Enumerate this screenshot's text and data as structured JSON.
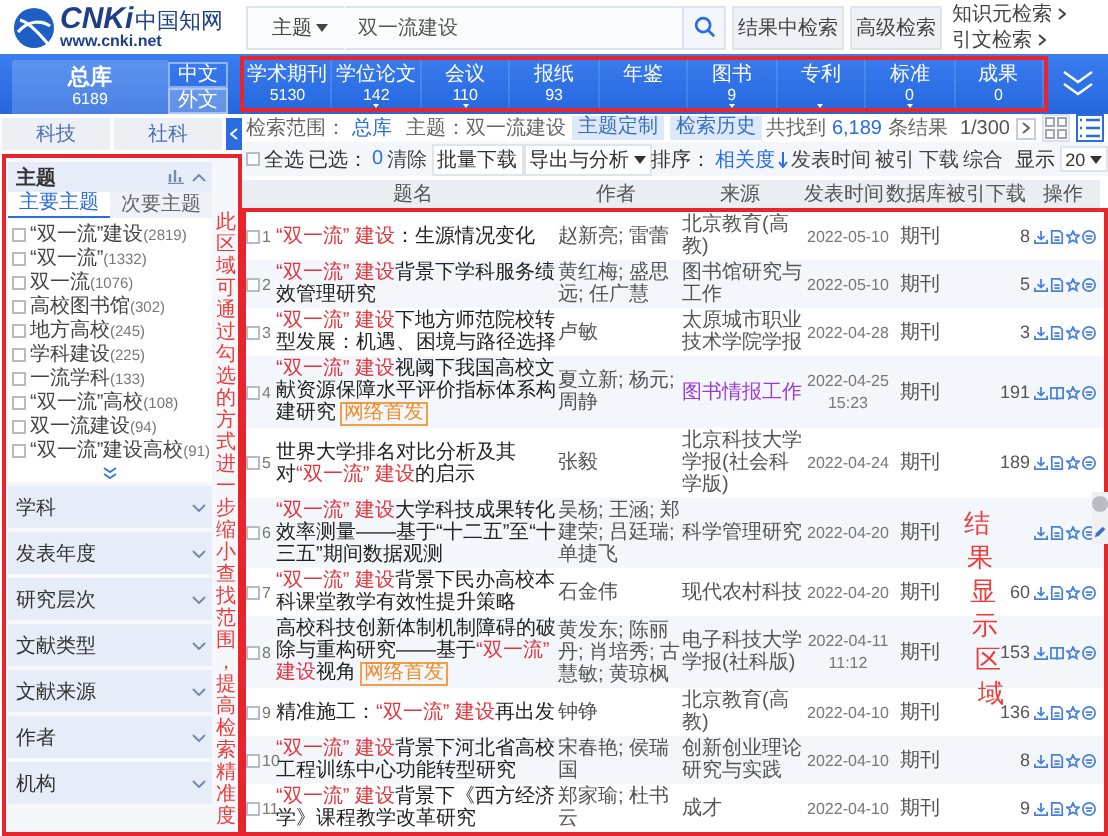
{
  "logo": {
    "brand": "CNKi",
    "name": "中国知网",
    "url": "www.cnki.net"
  },
  "search": {
    "field": "主题",
    "value": "双一流建设",
    "buttons": [
      "结果中检索",
      "高级检索"
    ],
    "links": [
      "知识元检索",
      "引文检索"
    ]
  },
  "database": {
    "label": "总库",
    "count": "6189",
    "lang_tabs": [
      {
        "label": "中文",
        "selected": false
      },
      {
        "label": "外文",
        "selected": true
      }
    ]
  },
  "nav_tabs": [
    {
      "label": "学术期刊",
      "count": "5130",
      "menu": false
    },
    {
      "label": "学位论文",
      "count": "142",
      "menu": true
    },
    {
      "label": "会议",
      "count": "110",
      "menu": true
    },
    {
      "label": "报纸",
      "count": "93",
      "menu": false
    },
    {
      "label": "年鉴",
      "menu": false
    },
    {
      "label": "图书",
      "count": "9",
      "menu": true
    },
    {
      "label": "专利",
      "menu": true
    },
    {
      "label": "标准",
      "count": "0",
      "menu": true
    },
    {
      "label": "成果",
      "count": "0",
      "menu": false
    }
  ],
  "subject_tabs": [
    {
      "label": "科技",
      "selected": false
    },
    {
      "label": "社科",
      "selected": false
    }
  ],
  "facets": {
    "title": "主题",
    "expanded": true,
    "tabs": [
      {
        "label": "主要主题",
        "selected": true
      },
      {
        "label": "次要主题",
        "selected": false
      }
    ],
    "items": [
      {
        "label": "“双一流”建设",
        "count": "(2819)",
        "checked": false
      },
      {
        "label": "“双一流”",
        "count": "(1332)",
        "checked": false
      },
      {
        "label": "双一流",
        "count": "(1076)",
        "checked": false
      },
      {
        "label": "高校图书馆",
        "count": "(302)",
        "checked": false
      },
      {
        "label": "地方高校",
        "count": "(245)",
        "checked": false
      },
      {
        "label": "学科建设",
        "count": "(225)",
        "checked": false
      },
      {
        "label": "一流学科",
        "count": "(133)",
        "checked": false
      },
      {
        "label": "“双一流”高校",
        "count": "(108)",
        "checked": false
      },
      {
        "label": "双一流建设",
        "count": "(94)",
        "checked": false
      },
      {
        "label": "“双一流”建设高校",
        "count": "(91)",
        "checked": false
      }
    ],
    "sections": [
      {
        "title": "学科",
        "expanded": false
      },
      {
        "title": "发表年度",
        "expanded": false
      },
      {
        "title": "研究层次",
        "expanded": false
      },
      {
        "title": "文献类型",
        "expanded": false
      },
      {
        "title": "文献来源",
        "expanded": false
      },
      {
        "title": "作者",
        "expanded": false
      },
      {
        "title": "机构",
        "expanded": false
      }
    ]
  },
  "sidebar_note": "此区域可通过勾选的方式进一步缩小查找范围，提高检索精准度",
  "info": {
    "scope_label": "检索范围：",
    "scope": "总库",
    "query": "主题：双一流建设",
    "buttons": [
      "主题定制",
      "检索历史"
    ],
    "found_prefix": "共找到",
    "total": "6,189",
    "found_suffix": "条结果",
    "page": "1/300"
  },
  "toolbar": {
    "select_all": {
      "label": "全选",
      "checked": false
    },
    "selected_label": "已选：",
    "selected_count": "0",
    "clear": "清除",
    "buttons": [
      {
        "label": "批量下载",
        "menu": false
      },
      {
        "label": "导出与分析",
        "menu": true
      }
    ],
    "sort_label": "排序：",
    "sort_options": [
      {
        "label": "相关度",
        "selected": true
      },
      {
        "label": "发表时间",
        "selected": false
      },
      {
        "label": "被引",
        "selected": false
      },
      {
        "label": "下载",
        "selected": false
      },
      {
        "label": "综合",
        "selected": false
      }
    ],
    "page_size_label": "显示",
    "page_size": "20",
    "views": [
      {
        "kind": "grid",
        "selected": false
      },
      {
        "kind": "list",
        "selected": true
      }
    ]
  },
  "table": {
    "columns": [
      "题名",
      "作者",
      "来源",
      "发表时间",
      "数据库",
      "被引",
      "下载",
      "操作"
    ],
    "rows": [
      {
        "checked": false,
        "number": "1",
        "title": "**“双一流”** **建设**：生源情况变化",
        "authors": "赵新亮; 雷蕾",
        "source": "北京教育(高教)",
        "visited": false,
        "date": "2022-05-10",
        "database": "期刊",
        "downloads": "8",
        "kind": "page"
      },
      {
        "checked": false,
        "number": "2",
        "title": "**“双一流”** **建设**背景下学科服务绩效管理研究",
        "authors": "黄红梅; 盛思远; 任广慧",
        "source": "图书馆研究与工作",
        "visited": false,
        "date": "2022-05-10",
        "database": "期刊",
        "downloads": "5",
        "kind": "page"
      },
      {
        "checked": false,
        "number": "3",
        "title": "**“双一流”** **建设**下地方师范院校转型发展：机遇、困境与路径选择",
        "authors": "卢敏",
        "source": "太原城市职业技术学院学报",
        "visited": false,
        "date": "2022-04-28",
        "database": "期刊",
        "downloads": "3",
        "kind": "page"
      },
      {
        "checked": false,
        "number": "4",
        "title": "**“双一流”** **建设**视阈下我国高校文献资源保障水平评价指标体系构建研究",
        "badge": "网络首发",
        "authors": "夏立新; 杨元; 周静",
        "source": "图书情报工作",
        "visited": true,
        "date": "2022-04-25 15:23",
        "database": "期刊",
        "downloads": "191",
        "kind": "book"
      },
      {
        "checked": false,
        "number": "5",
        "title": "世界大学排名对比分析及其对**“双一流”** **建设**的启示",
        "authors": "张毅",
        "source": "北京科技大学学报(社会科学版)",
        "visited": false,
        "date": "2022-04-24",
        "database": "期刊",
        "downloads": "189",
        "kind": "page"
      },
      {
        "checked": false,
        "number": "6",
        "title": "**“双一流”** **建设**大学科技成果转化效率测量——基于“十二五”至“十三五”期间数据观测",
        "authors": "吴杨; 王涵; 郑建荣; 吕廷瑞; 单捷飞",
        "source": "科学管理研究",
        "visited": false,
        "date": "2022-04-20",
        "database": "期刊",
        "kind": "page"
      },
      {
        "checked": false,
        "number": "7",
        "title": "**“双一流”** **建设**背景下民办高校本科课堂教学有效性提升策略",
        "authors": "石金伟",
        "source": "现代农村科技",
        "visited": false,
        "date": "2022-04-20",
        "database": "期刊",
        "downloads": "60",
        "kind": "page"
      },
      {
        "checked": false,
        "number": "8",
        "title": "高校科技创新体制机制障碍的破除与重构研究——基于**“双一流”** **建设**视角",
        "badge": "网络首发",
        "authors": "黄发东; 陈丽丹; 肖培秀; 古慧敏; 黄琼枫",
        "source": "电子科技大学学报(社科版)",
        "visited": false,
        "date": "2022-04-11 11:12",
        "database": "期刊",
        "downloads": "153",
        "kind": "book"
      },
      {
        "checked": false,
        "number": "9",
        "title": "精准施工：**“双一流”** **建设**再出发",
        "authors": "钟铮",
        "source": "北京教育(高教)",
        "visited": false,
        "date": "2022-04-10",
        "database": "期刊",
        "downloads": "136",
        "kind": "page"
      },
      {
        "checked": false,
        "number": "10",
        "title": "**“双一流”** **建设**背景下河北省高校工程训练中心功能转型研究",
        "authors": "宋春艳; 侯瑞国",
        "source": "创新创业理论研究与实践",
        "visited": false,
        "date": "2022-04-10",
        "database": "期刊",
        "downloads": "8",
        "kind": "page"
      },
      {
        "checked": false,
        "number": "11",
        "title": "**“双一流”** **建设**背景下《西方经济学》课程教学改革研究",
        "authors": "郑家瑜; 杜书云",
        "source": "成才",
        "visited": false,
        "date": "2022-04-10",
        "database": "期刊",
        "downloads": "9",
        "kind": "page"
      }
    ]
  },
  "results_note": "结果显示区域"
}
